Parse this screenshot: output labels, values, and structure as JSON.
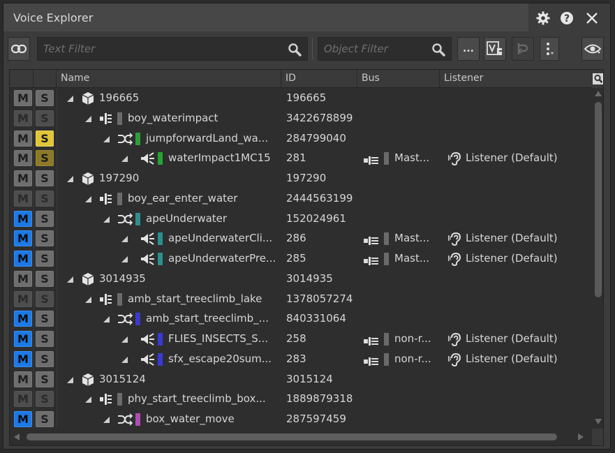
{
  "window": {
    "title": "Voice Explorer"
  },
  "titlebar": {
    "icons": [
      "gear-icon",
      "help-icon",
      "close-icon"
    ]
  },
  "toolbar": {
    "text_filter_placeholder": "Text Filter",
    "object_filter_placeholder": "Object Filter",
    "more_label": "...",
    "icons": [
      "link-icon",
      "search-icon",
      "search-icon",
      "voice-monitor-icon",
      "undo-icon",
      "vertical-dots-icon",
      "eye-icon"
    ]
  },
  "columns": {
    "name": "Name",
    "id": "ID",
    "bus": "Bus",
    "listener": "Listener"
  },
  "rows": [
    {
      "m": "off",
      "s": "off",
      "depth": 0,
      "type": "gameobject",
      "color": "",
      "name": "196665",
      "id": "196665",
      "bus": "",
      "listener": ""
    },
    {
      "m": "dim",
      "s": "dim",
      "depth": 1,
      "type": "event",
      "color": "#6b6b6b",
      "name": "boy_waterimpact",
      "id": "3422678899",
      "bus": "",
      "listener": ""
    },
    {
      "m": "off",
      "s": "yellow",
      "depth": 2,
      "type": "container",
      "color": "#2aa136",
      "name": "jumpforwardLand_wa...",
      "id": "284799040",
      "bus": "",
      "listener": ""
    },
    {
      "m": "off",
      "s": "dimyellow",
      "depth": 3,
      "type": "voice",
      "color": "#2aa136",
      "name": "waterImpact1MC15",
      "id": "281",
      "bus": "Mast...",
      "listener": "Listener (Default)"
    },
    {
      "m": "off",
      "s": "off",
      "depth": 0,
      "type": "gameobject",
      "color": "",
      "name": "197290",
      "id": "197290",
      "bus": "",
      "listener": ""
    },
    {
      "m": "dim",
      "s": "dim",
      "depth": 1,
      "type": "event",
      "color": "#6b6b6b",
      "name": "boy_ear_enter_water",
      "id": "2444563199",
      "bus": "",
      "listener": ""
    },
    {
      "m": "on",
      "s": "off",
      "depth": 2,
      "type": "container",
      "color": "#2f8e8e",
      "name": "apeUnderwater",
      "id": "152024961",
      "bus": "",
      "listener": ""
    },
    {
      "m": "on",
      "s": "off",
      "depth": 3,
      "type": "voice",
      "color": "#2f8e8e",
      "name": "apeUnderwaterCli...",
      "id": "286",
      "bus": "Mast...",
      "listener": "Listener (Default)"
    },
    {
      "m": "on",
      "s": "off",
      "depth": 3,
      "type": "voice",
      "color": "#2f8e8e",
      "name": "apeUnderwaterPre...",
      "id": "285",
      "bus": "Mast...",
      "listener": "Listener (Default)"
    },
    {
      "m": "off",
      "s": "off",
      "depth": 0,
      "type": "gameobject",
      "color": "",
      "name": "3014935",
      "id": "3014935",
      "bus": "",
      "listener": ""
    },
    {
      "m": "dim",
      "s": "dim",
      "depth": 1,
      "type": "event",
      "color": "#6b6b6b",
      "name": "amb_start_treeclimb_lake",
      "id": "1378057274",
      "bus": "",
      "listener": ""
    },
    {
      "m": "on",
      "s": "off",
      "depth": 2,
      "type": "container",
      "color": "#3a3ad1",
      "name": "amb_start_treeclimb_...",
      "id": "840331064",
      "bus": "",
      "listener": ""
    },
    {
      "m": "on",
      "s": "off",
      "depth": 3,
      "type": "voice",
      "color": "#3a3ad1",
      "name": "FLIES_INSECTS_S...",
      "id": "258",
      "bus": "non-r...",
      "listener": "Listener (Default)"
    },
    {
      "m": "on",
      "s": "off",
      "depth": 3,
      "type": "voice",
      "color": "#3a3ad1",
      "name": "sfx_escape20sum...",
      "id": "283",
      "bus": "non-r...",
      "listener": "Listener (Default)"
    },
    {
      "m": "off",
      "s": "off",
      "depth": 0,
      "type": "gameobject",
      "color": "",
      "name": "3015124",
      "id": "3015124",
      "bus": "",
      "listener": ""
    },
    {
      "m": "dim",
      "s": "dim",
      "depth": 1,
      "type": "event",
      "color": "#6b6b6b",
      "name": "phy_start_treeclimb_box...",
      "id": "1889879318",
      "bus": "",
      "listener": ""
    },
    {
      "m": "on",
      "s": "off",
      "depth": 2,
      "type": "container",
      "color": "#b24ab8",
      "name": "box_water_move",
      "id": "287597459",
      "bus": "",
      "listener": ""
    }
  ],
  "button_labels": {
    "mute": "M",
    "solo": "S"
  }
}
